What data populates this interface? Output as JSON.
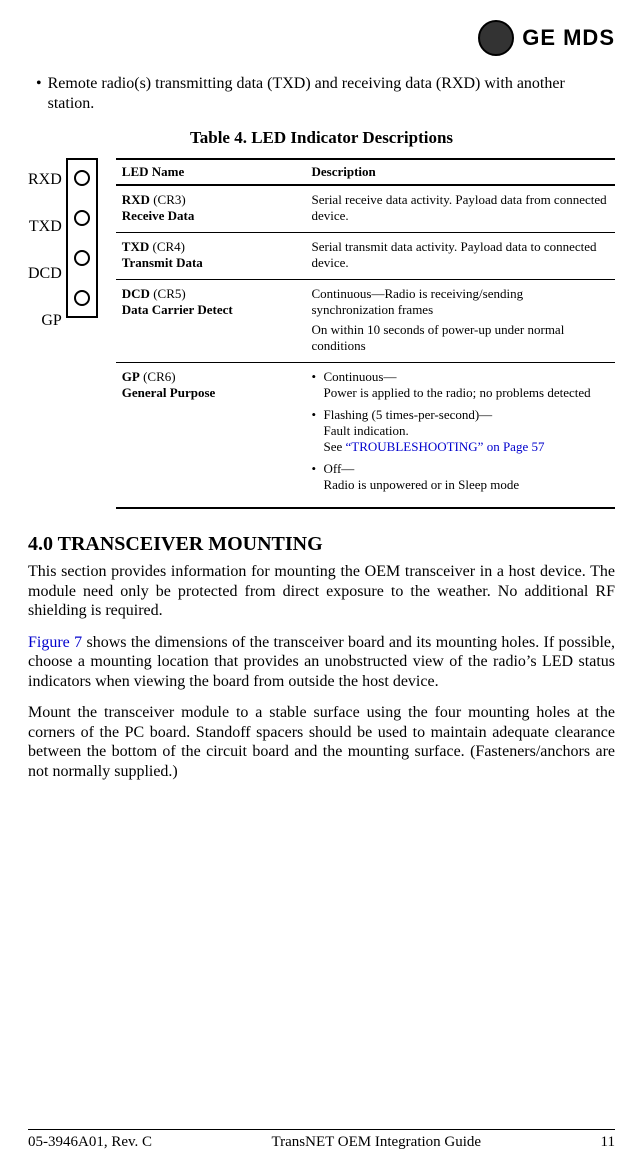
{
  "logo": {
    "brand": "GE MDS"
  },
  "bullet": {
    "prefix": "•",
    "text_a": "Remote radio(s) transmitting data (",
    "txd": "TXD",
    "text_b": ") and receiving data (",
    "rxd": "RXD",
    "text_c": ") with another station."
  },
  "table_title": "Table 4. LED Indicator Descriptions",
  "table": {
    "head_led": "LED Name",
    "head_desc": "Description",
    "rows": [
      {
        "name_main": "RXD",
        "name_code": " (CR3)",
        "name_sub": "Receive Data",
        "desc": "Serial receive data activity. Payload data from connected device."
      },
      {
        "name_main": "TXD",
        "name_code": " (CR4)",
        "name_sub": "Transmit Data",
        "desc": "Serial transmit data activity. Payload data to connected device."
      },
      {
        "name_main": "DCD",
        "name_code": " (CR5)",
        "name_sub": "Data Carrier Detect",
        "desc_a": "Continuous—Radio is receiving/sending synchronization frames",
        "desc_b": "On within 10 seconds of power-up under normal conditions"
      },
      {
        "name_main": "GP",
        "name_code": " (CR6)",
        "name_sub": "General Purpose",
        "item1_head": "Continuous—",
        "item1_body": "Power is applied to the radio; no problems detected",
        "item2_head": "Flashing (5 times-per-second)—",
        "item2_body_a": "Fault indication.",
        "item2_body_b": "See ",
        "item2_link": "“TROUBLESHOOTING” on Page 57",
        "item3_head": "Off—",
        "item3_body": "Radio is unpowered or in Sleep mode"
      }
    ]
  },
  "diagram": {
    "labels": [
      "RXD",
      "TXD",
      "DCD",
      "GP"
    ]
  },
  "section": {
    "heading": "4.0   TRANSCEIVER MOUNTING",
    "p1": "This section provides information for mounting the OEM transceiver in a host device. The module need only be protected from direct exposure to the weather. No additional RF shielding is required.",
    "p2_link": "Figure 7",
    "p2_rest": " shows the dimensions of the transceiver board and its mounting holes. If possible, choose a mounting location that provides an unobstructed view of the radio’s LED status indicators when viewing the board from outside the host device.",
    "p3": "Mount the transceiver module to a stable surface using the four mounting holes at the corners of the PC board. Standoff spacers should be used to maintain adequate clearance between the bottom of the circuit board and the mounting surface. (Fasteners/anchors are not normally supplied.)"
  },
  "footer": {
    "left": "05-3946A01, Rev. C",
    "center": "TransNET OEM Integration Guide",
    "right": "11"
  }
}
